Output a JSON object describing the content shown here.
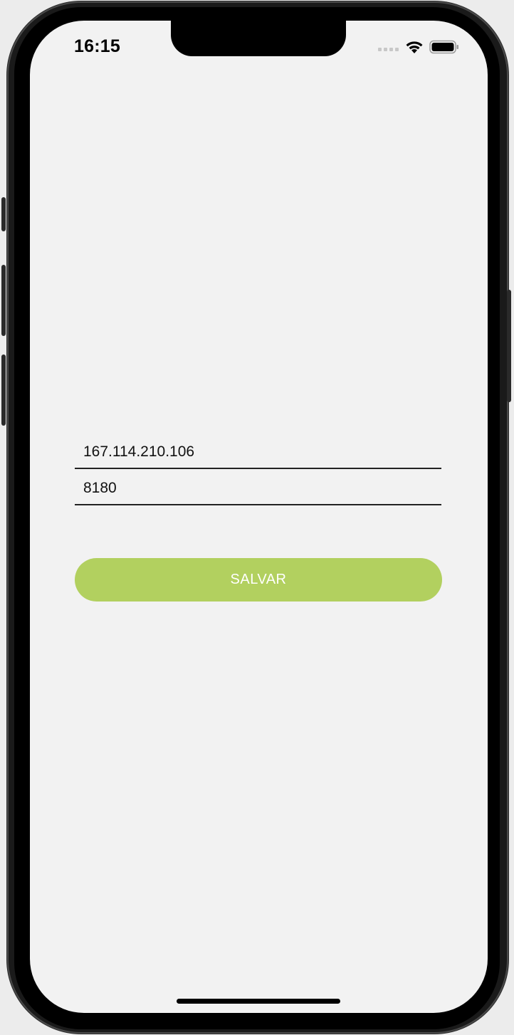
{
  "status_bar": {
    "time": "16:15",
    "icons": [
      "cellular-signal-icon",
      "wifi-icon",
      "battery-icon"
    ]
  },
  "form": {
    "ip_field": {
      "value": "167.114.210.106"
    },
    "port_field": {
      "value": "8180"
    },
    "save_button": {
      "label": "SALVAR"
    }
  },
  "colors": {
    "screen_background": "#f2f2f2",
    "button_background": "#b2d05f",
    "button_text": "#ffffff",
    "field_underline": "#222222"
  }
}
